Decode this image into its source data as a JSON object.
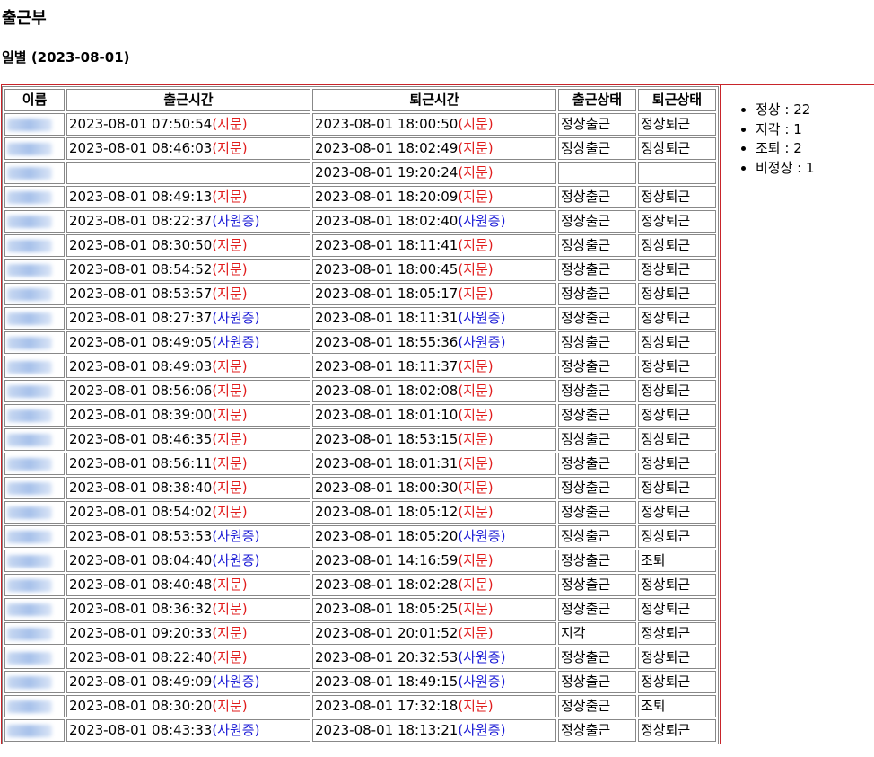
{
  "page": {
    "title": "출근부",
    "date_heading": "일별  (2023-08-01)"
  },
  "table": {
    "headers": [
      "이름",
      "출근시간",
      "퇴근시간",
      "출근상태",
      "퇴근상태"
    ],
    "rows": [
      {
        "in_time": "2023-08-01 07:50:54",
        "in_method": "(지문)",
        "out_time": "2023-08-01 18:00:50",
        "out_method": "(지문)",
        "in_status": "정상출근",
        "out_status": "정상퇴근"
      },
      {
        "in_time": "2023-08-01 08:46:03",
        "in_method": "(지문)",
        "out_time": "2023-08-01 18:02:49",
        "out_method": "(지문)",
        "in_status": "정상출근",
        "out_status": "정상퇴근"
      },
      {
        "in_time": "",
        "in_method": "",
        "out_time": "2023-08-01 19:20:24",
        "out_method": "(지문)",
        "in_status": "",
        "out_status": ""
      },
      {
        "in_time": "2023-08-01 08:49:13",
        "in_method": "(지문)",
        "out_time": "2023-08-01 18:20:09",
        "out_method": "(지문)",
        "in_status": "정상출근",
        "out_status": "정상퇴근"
      },
      {
        "in_time": "2023-08-01 08:22:37",
        "in_method": "(사원증)",
        "out_time": "2023-08-01 18:02:40",
        "out_method": "(사원증)",
        "in_status": "정상출근",
        "out_status": "정상퇴근"
      },
      {
        "in_time": "2023-08-01 08:30:50",
        "in_method": "(지문)",
        "out_time": "2023-08-01 18:11:41",
        "out_method": "(지문)",
        "in_status": "정상출근",
        "out_status": "정상퇴근"
      },
      {
        "in_time": "2023-08-01 08:54:52",
        "in_method": "(지문)",
        "out_time": "2023-08-01 18:00:45",
        "out_method": "(지문)",
        "in_status": "정상출근",
        "out_status": "정상퇴근"
      },
      {
        "in_time": "2023-08-01 08:53:57",
        "in_method": "(지문)",
        "out_time": "2023-08-01 18:05:17",
        "out_method": "(지문)",
        "in_status": "정상출근",
        "out_status": "정상퇴근"
      },
      {
        "in_time": "2023-08-01 08:27:37",
        "in_method": "(사원증)",
        "out_time": "2023-08-01 18:11:31",
        "out_method": "(사원증)",
        "in_status": "정상출근",
        "out_status": "정상퇴근"
      },
      {
        "in_time": "2023-08-01 08:49:05",
        "in_method": "(사원증)",
        "out_time": "2023-08-01 18:55:36",
        "out_method": "(사원증)",
        "in_status": "정상출근",
        "out_status": "정상퇴근"
      },
      {
        "in_time": "2023-08-01 08:49:03",
        "in_method": "(지문)",
        "out_time": "2023-08-01 18:11:37",
        "out_method": "(지문)",
        "in_status": "정상출근",
        "out_status": "정상퇴근"
      },
      {
        "in_time": "2023-08-01 08:56:06",
        "in_method": "(지문)",
        "out_time": "2023-08-01 18:02:08",
        "out_method": "(지문)",
        "in_status": "정상출근",
        "out_status": "정상퇴근"
      },
      {
        "in_time": "2023-08-01 08:39:00",
        "in_method": "(지문)",
        "out_time": "2023-08-01 18:01:10",
        "out_method": "(지문)",
        "in_status": "정상출근",
        "out_status": "정상퇴근"
      },
      {
        "in_time": "2023-08-01 08:46:35",
        "in_method": "(지문)",
        "out_time": "2023-08-01 18:53:15",
        "out_method": "(지문)",
        "in_status": "정상출근",
        "out_status": "정상퇴근"
      },
      {
        "in_time": "2023-08-01 08:56:11",
        "in_method": "(지문)",
        "out_time": "2023-08-01 18:01:31",
        "out_method": "(지문)",
        "in_status": "정상출근",
        "out_status": "정상퇴근"
      },
      {
        "in_time": "2023-08-01 08:38:40",
        "in_method": "(지문)",
        "out_time": "2023-08-01 18:00:30",
        "out_method": "(지문)",
        "in_status": "정상출근",
        "out_status": "정상퇴근"
      },
      {
        "in_time": "2023-08-01 08:54:02",
        "in_method": "(지문)",
        "out_time": "2023-08-01 18:05:12",
        "out_method": "(지문)",
        "in_status": "정상출근",
        "out_status": "정상퇴근"
      },
      {
        "in_time": "2023-08-01 08:53:53",
        "in_method": "(사원증)",
        "out_time": "2023-08-01 18:05:20",
        "out_method": "(사원증)",
        "in_status": "정상출근",
        "out_status": "정상퇴근"
      },
      {
        "in_time": "2023-08-01 08:04:40",
        "in_method": "(사원증)",
        "out_time": "2023-08-01 14:16:59",
        "out_method": "(지문)",
        "in_status": "정상출근",
        "out_status": "조퇴"
      },
      {
        "in_time": "2023-08-01 08:40:48",
        "in_method": "(지문)",
        "out_time": "2023-08-01 18:02:28",
        "out_method": "(지문)",
        "in_status": "정상출근",
        "out_status": "정상퇴근"
      },
      {
        "in_time": "2023-08-01 08:36:32",
        "in_method": "(지문)",
        "out_time": "2023-08-01 18:05:25",
        "out_method": "(지문)",
        "in_status": "정상출근",
        "out_status": "정상퇴근"
      },
      {
        "in_time": "2023-08-01 09:20:33",
        "in_method": "(지문)",
        "out_time": "2023-08-01 20:01:52",
        "out_method": "(지문)",
        "in_status": "지각",
        "out_status": "정상퇴근"
      },
      {
        "in_time": "2023-08-01 08:22:40",
        "in_method": "(지문)",
        "out_time": "2023-08-01 20:32:53",
        "out_method": "(사원증)",
        "in_status": "정상출근",
        "out_status": "정상퇴근"
      },
      {
        "in_time": "2023-08-01 08:49:09",
        "in_method": "(사원증)",
        "out_time": "2023-08-01 18:49:15",
        "out_method": "(사원증)",
        "in_status": "정상출근",
        "out_status": "정상퇴근"
      },
      {
        "in_time": "2023-08-01 08:30:20",
        "in_method": "(지문)",
        "out_time": "2023-08-01 17:32:18",
        "out_method": "(지문)",
        "in_status": "정상출근",
        "out_status": "조퇴"
      },
      {
        "in_time": "2023-08-01 08:43:33",
        "in_method": "(사원증)",
        "out_time": "2023-08-01 18:13:21",
        "out_method": "(사원증)",
        "in_status": "정상출근",
        "out_status": "정상퇴근"
      }
    ]
  },
  "summary": [
    "정상 : 22",
    "지각 : 1",
    "조퇴 : 2",
    "비정상 : 1"
  ],
  "colors": {
    "fingerprint": "#e11d1d",
    "employee_card": "#1a1ad6",
    "frame_border": "#c8242a"
  }
}
